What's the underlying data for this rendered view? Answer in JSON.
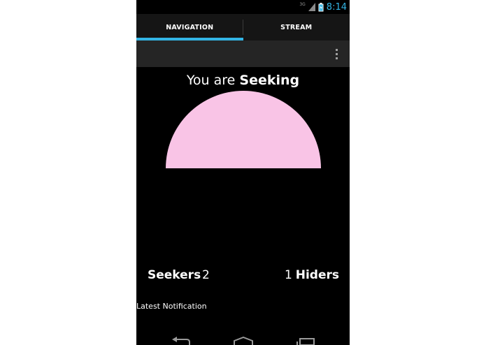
{
  "status_bar": {
    "network_type": "3G",
    "time": "8:14",
    "accent_color": "#33b5e5"
  },
  "tabs": [
    {
      "label": "NAVIGATION",
      "active": true
    },
    {
      "label": "STREAM",
      "active": false
    }
  ],
  "action_bar": {
    "overflow_icon": "overflow-menu-icon"
  },
  "main": {
    "status_prefix": "You are",
    "status_mode": "Seeking",
    "dome_color": "#f9c4e6",
    "seekers_label": "Seekers",
    "seekers_count": "2",
    "hiders_count": "1",
    "hiders_label": "Hiders",
    "notification_label": "Latest Notification"
  },
  "nav_bar": {
    "icons": [
      "back-icon",
      "home-icon",
      "recent-apps-icon"
    ]
  }
}
